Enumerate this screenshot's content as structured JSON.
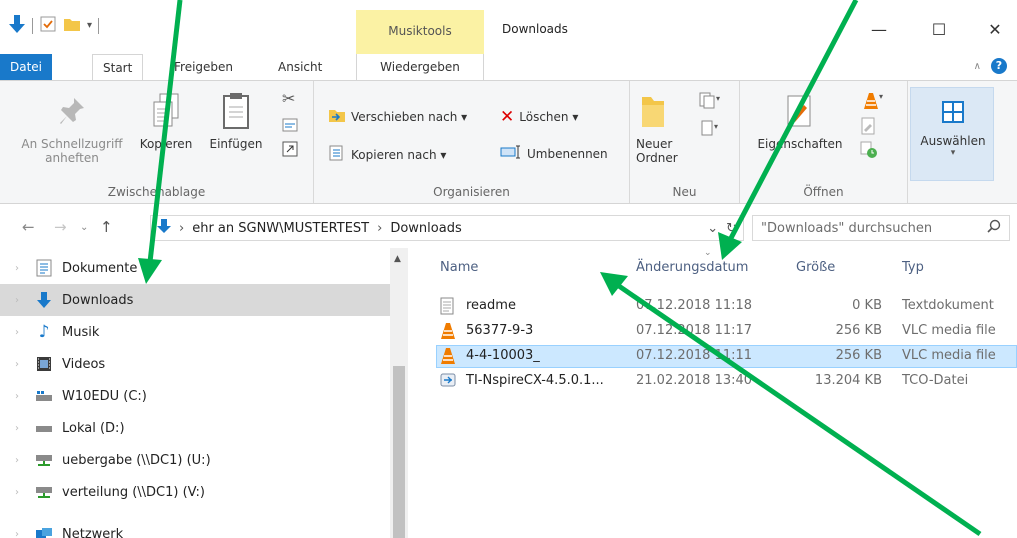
{
  "window": {
    "context_tab_group": "Musiktools",
    "title": "Downloads",
    "controls": {
      "minimize": "—",
      "maximize": "☐",
      "close": "✕"
    }
  },
  "tabs": {
    "file": "Datei",
    "start": "Start",
    "share": "Freigeben",
    "view": "Ansicht",
    "play": "Wiedergeben"
  },
  "ribbon": {
    "clipboard": {
      "label": "Zwischenablage",
      "pin_quick_access_line1": "An Schnellzugriff",
      "pin_quick_access_line2": "anheften",
      "copy": "Kopieren",
      "paste": "Einfügen"
    },
    "organize": {
      "label": "Organisieren",
      "move_to": "Verschieben nach ▾",
      "copy_to": "Kopieren nach ▾",
      "delete": "Löschen ▾",
      "rename": "Umbenennen"
    },
    "new": {
      "label": "Neu",
      "new_folder_line1": "Neuer",
      "new_folder_line2": "Ordner"
    },
    "open": {
      "label": "Öffnen",
      "properties": "Eigenschaften"
    },
    "select": {
      "select_label": "Auswählen"
    }
  },
  "address": {
    "segments": [
      "ehr an SGNW\\MUSTERTEST",
      "Downloads"
    ],
    "separator": "›",
    "refresh": "↻",
    "dropdown": "⌄"
  },
  "search": {
    "placeholder": "\"Downloads\" durchsuchen"
  },
  "sidebar": {
    "items": [
      {
        "label": "Dokumente",
        "icon": "document-icon"
      },
      {
        "label": "Downloads",
        "icon": "download-icon",
        "selected": true
      },
      {
        "label": "Musik",
        "icon": "music-icon"
      },
      {
        "label": "Videos",
        "icon": "video-icon"
      },
      {
        "label": "W10EDU (C:)",
        "icon": "system-drive-icon"
      },
      {
        "label": "Lokal (D:)",
        "icon": "drive-icon"
      },
      {
        "label": "uebergabe (\\\\DC1) (U:)",
        "icon": "network-drive-icon"
      },
      {
        "label": "verteilung (\\\\DC1) (V:)",
        "icon": "network-drive-icon"
      },
      {
        "label": "Netzwerk",
        "icon": "network-icon"
      }
    ]
  },
  "files": {
    "columns": {
      "name": "Name",
      "date": "Änderungsdatum",
      "size": "Größe",
      "type": "Typ"
    },
    "rows": [
      {
        "name": "readme",
        "date": "07.12.2018 11:18",
        "size": "0 KB",
        "type": "Textdokument",
        "icon": "text-file-icon"
      },
      {
        "name": "56377-9-3",
        "date": "07.12.2018 11:17",
        "size": "256 KB",
        "type": "VLC media file",
        "icon": "vlc-icon"
      },
      {
        "name": "4-4-10003_",
        "date": "07.12.2018 11:11",
        "size": "256 KB",
        "type": "VLC media file",
        "icon": "vlc-icon",
        "selected": true
      },
      {
        "name": "TI-NspireCX-4.5.0.1...",
        "date": "21.02.2018 13:40",
        "size": "13.204 KB",
        "type": "TCO-Datei",
        "icon": "tco-file-icon"
      }
    ]
  },
  "colors": {
    "accent": "#1979ca",
    "context_tab": "#fbf2a4",
    "selection": "#cce8ff",
    "sidebar_selection": "#d9d9d9",
    "annotation_arrow": "#00b050"
  }
}
